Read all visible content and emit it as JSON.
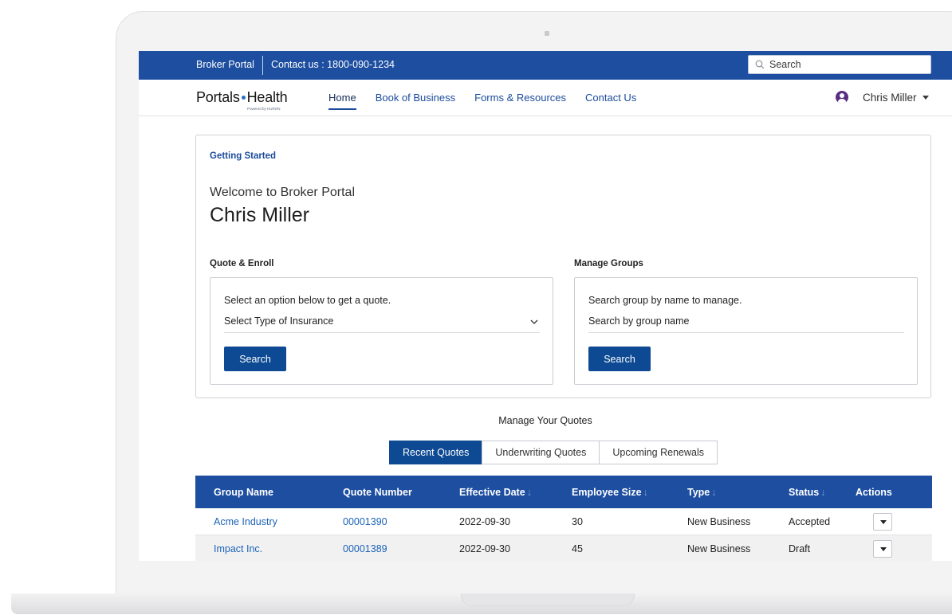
{
  "utility_bar": {
    "portal_name": "Broker Portal",
    "contact": "Contact us : 1800-090-1234",
    "search_placeholder": "Search"
  },
  "nav": {
    "logo_left": "Portals",
    "logo_right": "Health",
    "logo_powered": "Powered by HURON",
    "links": [
      {
        "label": "Home",
        "active": true
      },
      {
        "label": "Book of Business",
        "active": false
      },
      {
        "label": "Forms & Resources",
        "active": false
      },
      {
        "label": "Contact Us",
        "active": false
      }
    ],
    "user_name": "Chris Miller"
  },
  "getting_started": {
    "title": "Getting Started",
    "welcome": "Welcome to Broker Portal",
    "name": "Chris Miller",
    "quote_enroll": {
      "label": "Quote & Enroll",
      "hint": "Select an option below to get a quote.",
      "select_value": "Select Type of Insurance",
      "button": "Search"
    },
    "manage_groups": {
      "label": "Manage Groups",
      "hint": "Search group by name to manage.",
      "input_placeholder": "Search by group name",
      "button": "Search"
    }
  },
  "quotes": {
    "title": "Manage Your Quotes",
    "tabs": [
      {
        "label": "Recent Quotes",
        "active": true
      },
      {
        "label": "Underwriting Quotes",
        "active": false
      },
      {
        "label": "Upcoming Renewals",
        "active": false
      }
    ],
    "columns": [
      {
        "label": "Group Name",
        "sortable": false
      },
      {
        "label": "Quote Number",
        "sortable": false
      },
      {
        "label": "Effective Date",
        "sortable": true
      },
      {
        "label": "Employee Size",
        "sortable": true
      },
      {
        "label": "Type",
        "sortable": true
      },
      {
        "label": "Status",
        "sortable": true
      },
      {
        "label": "Actions",
        "sortable": false
      }
    ],
    "rows": [
      {
        "group": "Acme Industry",
        "quote": "00001390",
        "date": "2022-09-30",
        "size": "30",
        "type": "New Business",
        "status": "Accepted"
      },
      {
        "group": "Impact Inc.",
        "quote": "00001389",
        "date": "2022-09-30",
        "size": "45",
        "type": "New Business",
        "status": "Draft"
      }
    ]
  },
  "colors": {
    "primary_blue": "#1d4ea0",
    "button_blue": "#0d4a93",
    "link_blue": "#1b62b8",
    "avatar_purple": "#5a2d82"
  }
}
